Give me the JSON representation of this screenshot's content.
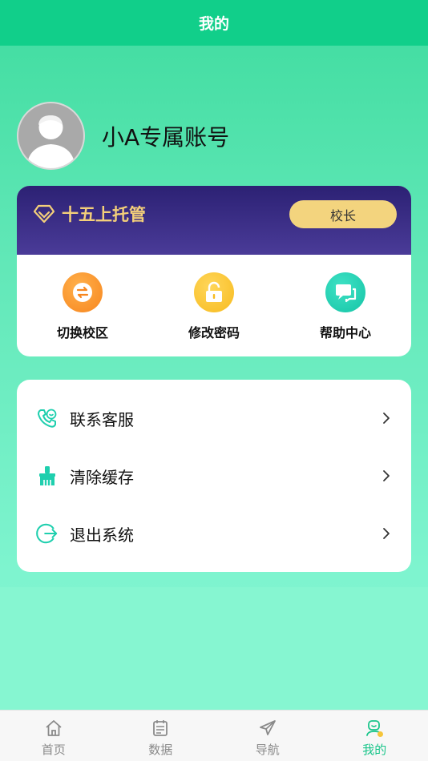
{
  "header": {
    "title": "我的"
  },
  "profile": {
    "account_name": "小A专属账号"
  },
  "vip": {
    "title": "十五上托管",
    "role": "校长"
  },
  "actions": [
    {
      "label": "切换校区",
      "icon": "switch-icon",
      "color": "#f79a2e"
    },
    {
      "label": "修改密码",
      "icon": "lock-icon",
      "color": "#f8c936"
    },
    {
      "label": "帮助中心",
      "icon": "chat-icon",
      "color": "#22d3b2"
    }
  ],
  "menu": [
    {
      "label": "联系客服",
      "icon": "phone-service-icon"
    },
    {
      "label": "清除缓存",
      "icon": "broom-icon"
    },
    {
      "label": "退出系统",
      "icon": "logout-icon"
    }
  ],
  "tabs": [
    {
      "label": "首页",
      "icon": "home-icon"
    },
    {
      "label": "数据",
      "icon": "calendar-icon"
    },
    {
      "label": "导航",
      "icon": "send-icon"
    },
    {
      "label": "我的",
      "icon": "user-icon",
      "active": true
    }
  ],
  "colors": {
    "primary": "#11cf8a",
    "gold": "#f3cf7a",
    "active_tab": "#19c58a"
  }
}
